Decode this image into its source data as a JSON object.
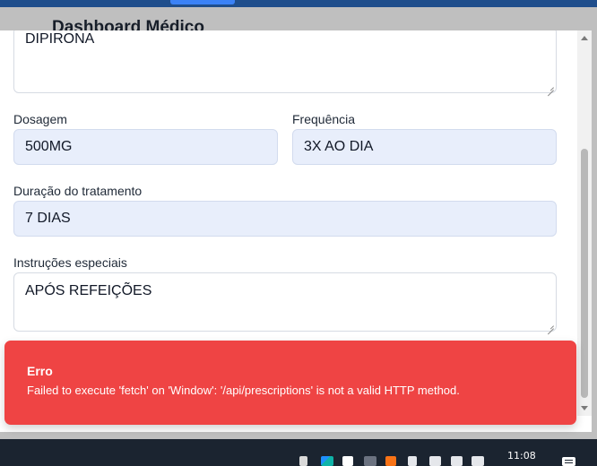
{
  "background": {
    "page_title": "Dashboard Médico"
  },
  "form": {
    "medication_value": "DIPIRONA",
    "dosage_label": "Dosagem",
    "dosage_value": "500MG",
    "frequency_label": "Frequência",
    "frequency_value": "3X AO DIA",
    "duration_label": "Duração do tratamento",
    "duration_value": "7 DIAS",
    "instructions_label": "Instruções especiais",
    "instructions_value": "APÓS REFEIÇÕES"
  },
  "toast": {
    "title": "Erro",
    "message": "Failed to execute 'fetch' on 'Window': '/api/prescriptions' is not a valid HTTP method.",
    "color": "#ef4444"
  },
  "taskbar": {
    "time": "11:08"
  },
  "colors": {
    "input_filled_bg": "#e8eefb",
    "appbar": "#1f4e8c"
  }
}
